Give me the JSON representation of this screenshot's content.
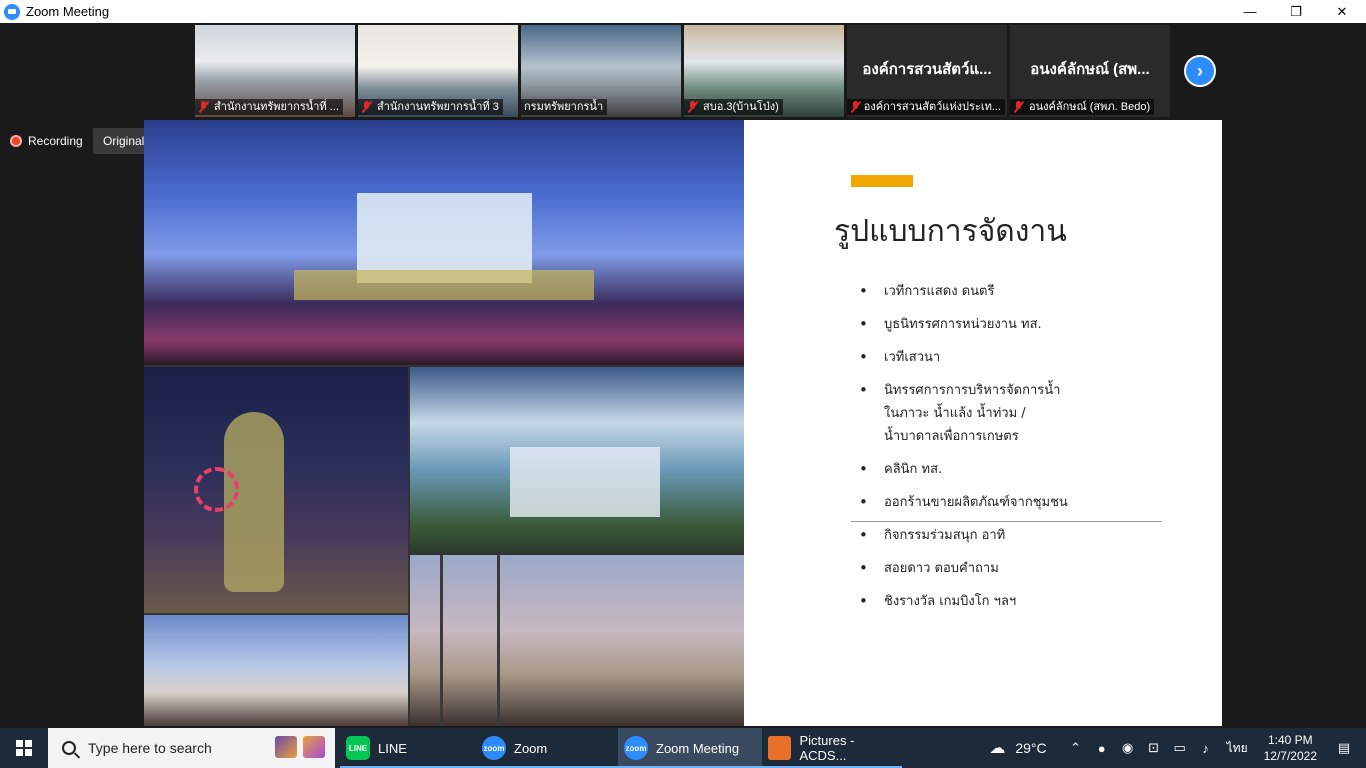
{
  "window": {
    "title": "Zoom Meeting",
    "minimize": "—",
    "restore": "❐",
    "close": "✕"
  },
  "thumbnails": [
    {
      "name": "สำนักงานทรัพยากรน้ำที่ ...",
      "video": true,
      "muted": true
    },
    {
      "name": "สำนักงานทรัพยากรน้ำที่ 3",
      "video": true,
      "muted": true
    },
    {
      "name": "กรมทรัพยากรน้ำ",
      "video": true,
      "muted": false,
      "active": true
    },
    {
      "name": "สบอ.3(บ้านโป่ง)",
      "video": true,
      "muted": true
    },
    {
      "name": "องค์การสวนสัตว์แห่งประเท...",
      "video": false,
      "muted": true,
      "display": "องค์การสวนสัตว์แ..."
    },
    {
      "name": "อนงค์ลักษณ์ (สพภ. Bedo)",
      "video": false,
      "muted": true,
      "display": "อนงค์ลักษณ์ (สพ..."
    }
  ],
  "next_arrow": "›",
  "recording": {
    "label": "Recording"
  },
  "original_sound": {
    "label": "Original Sound for Musicians: Off"
  },
  "slide": {
    "title": "รูปแบบการจัดงาน",
    "accent_color": "#f0a800",
    "bullets": [
      {
        "lines": [
          "เวทีการแสดง ดนตรี"
        ]
      },
      {
        "lines": [
          "บูธนิทรรศการหน่วยงาน ทส."
        ]
      },
      {
        "lines": [
          "เวทีเสวนา"
        ]
      },
      {
        "lines": [
          "นิทรรศการการบริหารจัดการน้ำ",
          "ในภาวะ น้ำแล้ง น้ำท่วม /",
          "น้ำบาดาลเพื่อการเกษตร"
        ]
      },
      {
        "lines": [
          "คลินิก ทส."
        ]
      },
      {
        "lines": [
          "ออกร้านขายผลิตภัณฑ์จากชุมชน"
        ]
      },
      {
        "lines": [
          "กิจกรรมร่วมสนุก อาทิ"
        ]
      },
      {
        "lines": [
          "สอยดาว  ตอบคำถาม"
        ]
      },
      {
        "lines": [
          "ชิงรางวัล  เกมบิงโก ฯลฯ"
        ]
      }
    ]
  },
  "taskbar": {
    "search_placeholder": "Type here to search",
    "apps": [
      {
        "label": "LINE",
        "icon": "line-icon",
        "color": "#06c755",
        "icon_text": "LINE"
      },
      {
        "label": "Zoom",
        "icon": "zoom-icon",
        "color": "#2d8cff",
        "icon_text": "zoom"
      },
      {
        "label": "Zoom Meeting",
        "icon": "zoom-icon",
        "color": "#2d8cff",
        "icon_text": "zoom"
      },
      {
        "label": "Pictures - ACDS...",
        "icon": "acdsee-icon",
        "color": "#e8702a",
        "icon_text": ""
      }
    ],
    "weather": "29°C",
    "language": "ไทย",
    "time": "1:40 PM",
    "date": "12/7/2022"
  }
}
